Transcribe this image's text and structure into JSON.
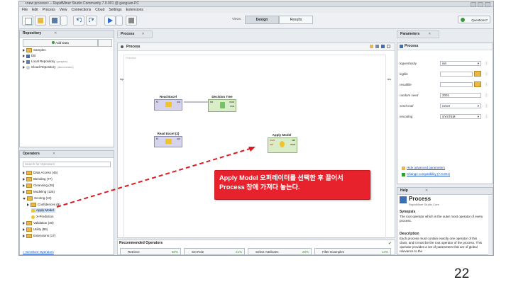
{
  "window": {
    "title": "<new process> – RapidMiner Studio Community 7.0.001 @ gangsan-PC"
  },
  "menu": [
    "File",
    "Edit",
    "Process",
    "View",
    "Connections",
    "Cloud",
    "Settings",
    "Extensions"
  ],
  "toolbar": {
    "views_label": "Views:",
    "tab_design": "Design",
    "tab_results": "Results",
    "questions": "Questions?"
  },
  "repository": {
    "header": "Repository",
    "add_data": "Add Data",
    "items": [
      "Samples",
      "DB",
      "Local Repository",
      "Cloud Repository"
    ],
    "local_suffix": "(gangsan)",
    "cloud_suffix": "(disconnected)"
  },
  "operators": {
    "header": "Operators",
    "search_placeholder": "Search for Operators",
    "items": [
      "Data Access (46)",
      "Blending (77)",
      "Cleansing (26)",
      "Modeling (125)",
      "Scoring (10)",
      "Confidences (8)",
      "Apply Model",
      "X-Prediction",
      "Validation (30)",
      "Utility (85)",
      "Extensions (17)"
    ],
    "get_more": "» Get More Operators"
  },
  "process": {
    "tab": "Process",
    "header": "Process",
    "inner_label": "Process",
    "inp": "inp",
    "res": "res",
    "ops": {
      "read_excel": {
        "name": "Read Excel",
        "port_in": "fil",
        "port_out": "out"
      },
      "decision_tree": {
        "name": "Decision Tree",
        "port_in": "tra",
        "port_mod": "mod",
        "port_exa": "exa"
      },
      "read_excel2": {
        "name": "Read Excel (2)",
        "port_in": "fil",
        "port_out": "out"
      },
      "apply_model": {
        "name": "Apply Model",
        "port_mod_in": "mod",
        "port_unl": "unl",
        "port_lab": "lab",
        "port_mod_out": "mod"
      }
    }
  },
  "recommended": {
    "header": "Recommended Operators",
    "items": [
      {
        "label": "Retrieve",
        "pct": "60%"
      },
      {
        "label": "Set Role",
        "pct": "21%"
      },
      {
        "label": "Select Attributes",
        "pct": "20%"
      },
      {
        "label": "Filter Examples",
        "pct": "14%"
      }
    ]
  },
  "parameters": {
    "header": "Parameters",
    "context": "Process",
    "rows": [
      {
        "label": "logverbosity",
        "value": "init"
      },
      {
        "label": "logfile",
        "value": ""
      },
      {
        "label": "resultfile",
        "value": ""
      },
      {
        "label": "random seed",
        "value": "2001"
      },
      {
        "label": "send mail",
        "value": "never"
      },
      {
        "label": "encoding",
        "value": "SYSTEM"
      }
    ],
    "hide_advanced": "Hide advanced parameters",
    "change_compat": "Change compatibility (7.0.001)"
  },
  "help": {
    "header": "Help",
    "title": "Process",
    "subtitle": "RapidMiner Studio Core",
    "synopsis_h": "Synopsis",
    "synopsis": "The root operator which is the outer most operator of every process.",
    "desc_h": "Description",
    "desc": "Each process must contain exactly one operator of this class, and it must be the root operator of the process. This operator provides a set of parameters that are of global relevance to the"
  },
  "callout": {
    "text": "Apply Model 오퍼레이터를 선택한 후 끌어서 Process 창에 가져다 놓는다."
  },
  "page_number": "22",
  "colors": {
    "callout": "#e8222d",
    "arrow": "#d81c24",
    "accent": "#1a55c4"
  }
}
